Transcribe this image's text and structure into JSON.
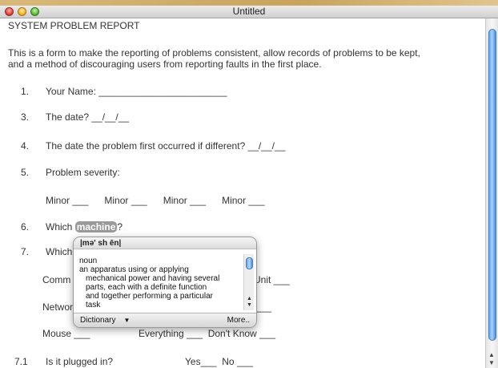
{
  "window": {
    "title": "Untitled"
  },
  "doc": {
    "heading": "SYSTEM PROBLEM REPORT",
    "intro_1": "This is a form to make the reporting of problems consistent, allow records of problems to be kept,",
    "intro_2": "and a method of discouraging users from reporting faults in the first place.",
    "items": [
      {
        "num": "1.",
        "text": "Your Name: ________________________"
      },
      {
        "num": "3.",
        "text": "The date? __/__/__"
      },
      {
        "num": "4.",
        "text": "The date the problem first occurred if different? __/__/__"
      },
      {
        "num": "5.",
        "text": "Problem severity:"
      }
    ],
    "severity_row": "Minor ___      Minor ___      Minor ___      Minor ___",
    "item6_num": "6.",
    "item6_prefix": "Which",
    "item6_word": "machine",
    "item6_suffix": "?",
    "item7_num": "7.",
    "item7_prefix": "Which",
    "row_comm_left": "Comm",
    "row_comm_right": "Unit ___",
    "row_netw_left": "Networ",
    "row_netw_right": "___",
    "row_mouse": "Mouse ___",
    "row_everything": "Everything ___  Don't Know ___",
    "item71_num": "7.1",
    "item71_text": "Is it plugged in?",
    "item71_answer": "Yes___  No ___"
  },
  "dictionary_popup": {
    "pronunciation": "|mə' sh ēn|",
    "part_of_speech": "noun",
    "definition_lines": [
      "an apparatus using or applying",
      "mechanical power and having several",
      "parts, each with a definite function",
      "and together performing a particular",
      "task"
    ],
    "source": "Dictionary",
    "more": "More.."
  }
}
